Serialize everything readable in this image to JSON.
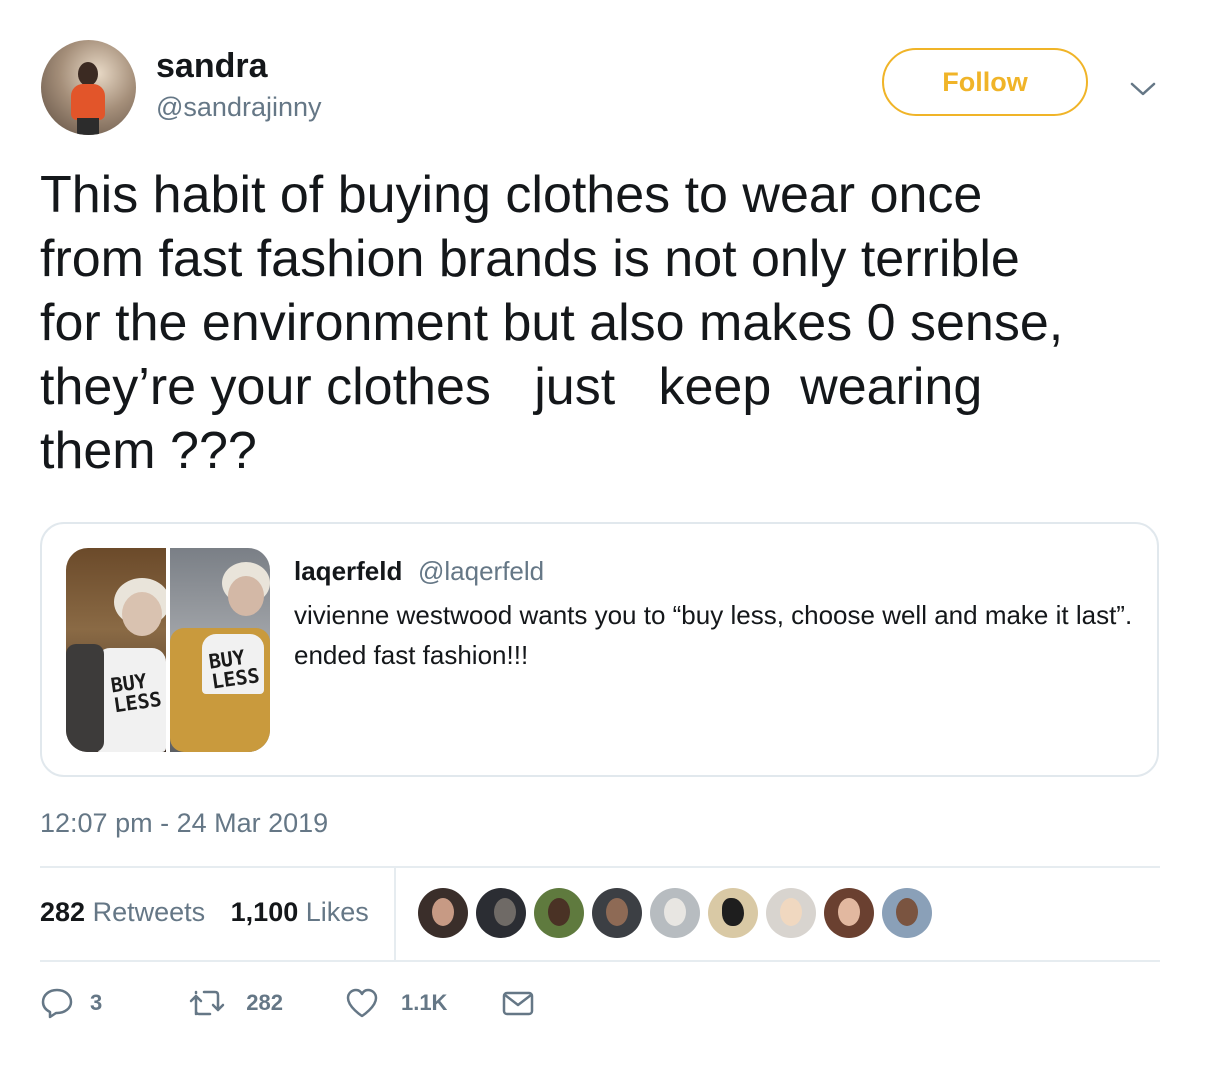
{
  "author": {
    "name": "sandra",
    "handle": "@sandrajinny"
  },
  "follow_label": "Follow",
  "tweet_lines": [
    "This habit of buying clothes to wear once",
    "from fast fashion brands is not only terrible",
    "for the environment but also makes 0 sense,",
    "they’re your clothes   just   keep  wearing",
    "them ???"
  ],
  "quoted": {
    "name": "laqerfeld",
    "handle": "@laqerfeld",
    "text": "vivienne westwood wants you to “buy less, choose well and make it last”. ended fast fashion!!!",
    "shirt_text_1": "BUY LESS",
    "shirt_text_2": "BUY LESS"
  },
  "timestamp": "12:07 pm - 24 Mar 2019",
  "stats": {
    "retweets_count": "282",
    "retweets_label": "Retweets",
    "likes_count": "1,100",
    "likes_label": "Likes"
  },
  "actions": {
    "reply_count": "3",
    "retweet_count": "282",
    "like_count": "1.1K"
  },
  "colors": {
    "accent": "#f0b428",
    "muted": "#657786",
    "text": "#14171a",
    "border": "#e1e8ed"
  },
  "icons": {
    "more": "chevron-down-icon",
    "reply": "reply-icon",
    "retweet": "retweet-icon",
    "like": "heart-icon",
    "dm": "envelope-icon"
  }
}
